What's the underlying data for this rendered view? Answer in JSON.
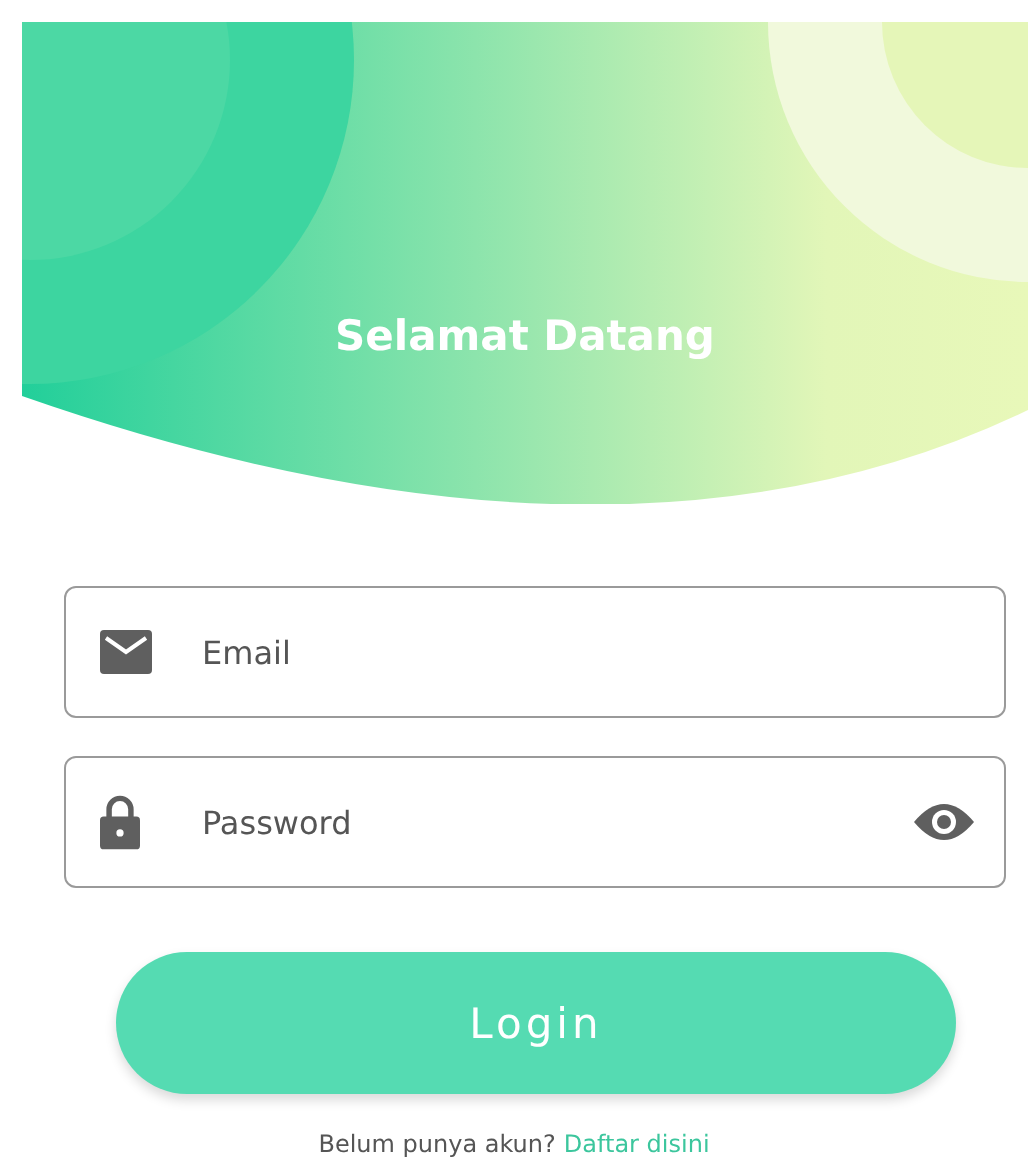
{
  "header": {
    "title": "Selamat Datang"
  },
  "fields": [
    {
      "kind": "email",
      "placeholder": "Email"
    },
    {
      "kind": "password",
      "placeholder": "Password",
      "reveal_toggle": true
    }
  ],
  "login_button": {
    "label": "Login"
  },
  "signup": {
    "prompt": "Belum punya akun?",
    "link": "Daftar disini"
  }
}
